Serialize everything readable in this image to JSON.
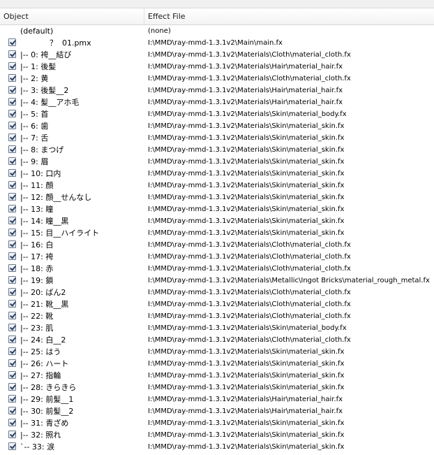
{
  "header": {
    "object_label": "Object",
    "effect_label": "Effect File"
  },
  "rows": [
    {
      "object": "(default)",
      "effect": "(none)",
      "checkbox": false
    },
    {
      "object": "            ？  01.pmx",
      "effect": "I:\\MMD\\ray-mmd-1.3.1v2\\Main\\main.fx",
      "checkbox": true
    },
    {
      "object": "|-- 0: 袴__結び",
      "effect": "I:\\MMD\\ray-mmd-1.3.1v2\\Materials\\Cloth\\material_cloth.fx",
      "checkbox": true
    },
    {
      "object": "|-- 1: 後髪",
      "effect": "I:\\MMD\\ray-mmd-1.3.1v2\\Materials\\Hair\\material_hair.fx",
      "checkbox": true
    },
    {
      "object": "|-- 2: 黄",
      "effect": "I:\\MMD\\ray-mmd-1.3.1v2\\Materials\\Cloth\\material_cloth.fx",
      "checkbox": true
    },
    {
      "object": "|-- 3: 後髪__2",
      "effect": "I:\\MMD\\ray-mmd-1.3.1v2\\Materials\\Hair\\material_hair.fx",
      "checkbox": true
    },
    {
      "object": "|-- 4: 髪__アホ毛",
      "effect": "I:\\MMD\\ray-mmd-1.3.1v2\\Materials\\Hair\\material_hair.fx",
      "checkbox": true
    },
    {
      "object": "|-- 5: 首",
      "effect": "I:\\MMD\\ray-mmd-1.3.1v2\\Materials\\Skin\\material_body.fx",
      "checkbox": true
    },
    {
      "object": "|-- 6: 歯",
      "effect": "I:\\MMD\\ray-mmd-1.3.1v2\\Materials\\Skin\\material_skin.fx",
      "checkbox": true
    },
    {
      "object": "|-- 7: 舌",
      "effect": "I:\\MMD\\ray-mmd-1.3.1v2\\Materials\\Skin\\material_skin.fx",
      "checkbox": true
    },
    {
      "object": "|-- 8: まつげ",
      "effect": "I:\\MMD\\ray-mmd-1.3.1v2\\Materials\\Skin\\material_skin.fx",
      "checkbox": true
    },
    {
      "object": "|-- 9: 眉",
      "effect": "I:\\MMD\\ray-mmd-1.3.1v2\\Materials\\Skin\\material_skin.fx",
      "checkbox": true
    },
    {
      "object": "|-- 10: 口内",
      "effect": "I:\\MMD\\ray-mmd-1.3.1v2\\Materials\\Skin\\material_skin.fx",
      "checkbox": true
    },
    {
      "object": "|-- 11: 顔",
      "effect": "I:\\MMD\\ray-mmd-1.3.1v2\\Materials\\Skin\\material_skin.fx",
      "checkbox": true
    },
    {
      "object": "|-- 12: 顔__せんなし",
      "effect": "I:\\MMD\\ray-mmd-1.3.1v2\\Materials\\Skin\\material_skin.fx",
      "checkbox": true
    },
    {
      "object": "|-- 13: 瞳",
      "effect": "I:\\MMD\\ray-mmd-1.3.1v2\\Materials\\Skin\\material_skin.fx",
      "checkbox": true
    },
    {
      "object": "|-- 14: 瞳__黒",
      "effect": "I:\\MMD\\ray-mmd-1.3.1v2\\Materials\\Skin\\material_skin.fx",
      "checkbox": true
    },
    {
      "object": "|-- 15: 目__ハイライト",
      "effect": "I:\\MMD\\ray-mmd-1.3.1v2\\Materials\\Skin\\material_skin.fx",
      "checkbox": true
    },
    {
      "object": "|-- 16: 白",
      "effect": "I:\\MMD\\ray-mmd-1.3.1v2\\Materials\\Cloth\\material_cloth.fx",
      "checkbox": true
    },
    {
      "object": "|-- 17: 袴",
      "effect": "I:\\MMD\\ray-mmd-1.3.1v2\\Materials\\Cloth\\material_cloth.fx",
      "checkbox": true
    },
    {
      "object": "|-- 18: 赤",
      "effect": "I:\\MMD\\ray-mmd-1.3.1v2\\Materials\\Cloth\\material_cloth.fx",
      "checkbox": true
    },
    {
      "object": "|-- 19: 鎖",
      "effect": "I:\\MMD\\ray-mmd-1.3.1v2\\Materials\\Metallic\\Ingot Bricks\\material_rough_metal.fx",
      "checkbox": true
    },
    {
      "object": "|-- 20: ばん2",
      "effect": "I:\\MMD\\ray-mmd-1.3.1v2\\Materials\\Cloth\\material_cloth.fx",
      "checkbox": true
    },
    {
      "object": "|-- 21: 靴__黒",
      "effect": "I:\\MMD\\ray-mmd-1.3.1v2\\Materials\\Cloth\\material_cloth.fx",
      "checkbox": true
    },
    {
      "object": "|-- 22: 靴",
      "effect": "I:\\MMD\\ray-mmd-1.3.1v2\\Materials\\Cloth\\material_cloth.fx",
      "checkbox": true
    },
    {
      "object": "|-- 23: 肌",
      "effect": "I:\\MMD\\ray-mmd-1.3.1v2\\Materials\\Skin\\material_body.fx",
      "checkbox": true
    },
    {
      "object": "|-- 24: 白__2",
      "effect": "I:\\MMD\\ray-mmd-1.3.1v2\\Materials\\Cloth\\material_cloth.fx",
      "checkbox": true
    },
    {
      "object": "|-- 25: はう",
      "effect": "I:\\MMD\\ray-mmd-1.3.1v2\\Materials\\Skin\\material_skin.fx",
      "checkbox": true
    },
    {
      "object": "|-- 26: ハート",
      "effect": "I:\\MMD\\ray-mmd-1.3.1v2\\Materials\\Skin\\material_skin.fx",
      "checkbox": true
    },
    {
      "object": "|-- 27: 指輪",
      "effect": "I:\\MMD\\ray-mmd-1.3.1v2\\Materials\\Skin\\material_skin.fx",
      "checkbox": true
    },
    {
      "object": "|-- 28: きらきら",
      "effect": "I:\\MMD\\ray-mmd-1.3.1v2\\Materials\\Skin\\material_skin.fx",
      "checkbox": true
    },
    {
      "object": "|-- 29: 前髪__1",
      "effect": "I:\\MMD\\ray-mmd-1.3.1v2\\Materials\\Hair\\material_hair.fx",
      "checkbox": true
    },
    {
      "object": "|-- 30: 前髪__2",
      "effect": "I:\\MMD\\ray-mmd-1.3.1v2\\Materials\\Hair\\material_hair.fx",
      "checkbox": true
    },
    {
      "object": "|-- 31: 青ざめ",
      "effect": "I:\\MMD\\ray-mmd-1.3.1v2\\Materials\\Skin\\material_skin.fx",
      "checkbox": true
    },
    {
      "object": "|-- 32: 照れ",
      "effect": "I:\\MMD\\ray-mmd-1.3.1v2\\Materials\\Skin\\material_skin.fx",
      "checkbox": true
    },
    {
      "object": "`-- 33: 涙",
      "effect": "I:\\MMD\\ray-mmd-1.3.1v2\\Materials\\Skin\\material_skin.fx",
      "checkbox": true
    }
  ]
}
